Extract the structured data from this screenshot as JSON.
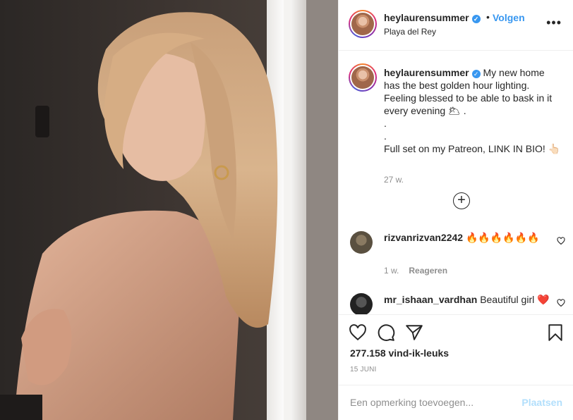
{
  "header": {
    "username": "heylaurensummer",
    "separator": "•",
    "follow_label": "Volgen",
    "location": "Playa del Rey",
    "more_label": "•••",
    "verified_glyph": "✓"
  },
  "caption": {
    "username": "heylaurensummer",
    "line1": "My new home has the best golden hour lighting. Feeling blessed to be able to bask in it every evening 🌥 .",
    "line2": ".",
    "line3": ".",
    "line4": "Full set on my Patreon, LINK IN BIO! 👆🏻",
    "time": "27 w."
  },
  "load_more_label": "+",
  "comments": [
    {
      "username": "rizvanrizvan2242",
      "text": "🔥🔥🔥🔥🔥🔥",
      "time": "1 w.",
      "reply_label": "Reageren"
    },
    {
      "username": "mr_ishaan_vardhan",
      "text": "Beautiful girl ❤️",
      "time": "",
      "reply_label": ""
    }
  ],
  "actions": {
    "like_icon": "heart-icon",
    "comment_icon": "comment-icon",
    "share_icon": "share-icon",
    "save_icon": "bookmark-icon"
  },
  "likes": "277.158 vind-ik-leuks",
  "date": "15 JUNI",
  "add_comment": {
    "placeholder": "Een opmerking toevoegen...",
    "post_label": "Plaatsen"
  },
  "colors": {
    "link_blue": "#3897f0",
    "post_disabled": "#b2dffc",
    "muted": "#8e8e8e",
    "text": "#262626"
  }
}
